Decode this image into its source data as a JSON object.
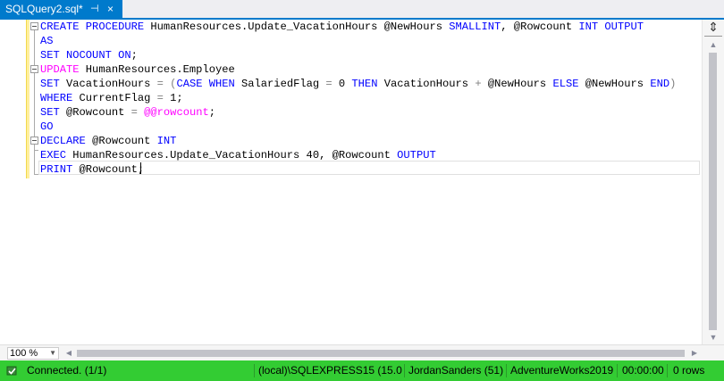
{
  "tab": {
    "title": "SQLQuery2.sql*",
    "pin": "⊣",
    "close": "×"
  },
  "editor": {
    "lines": [
      [
        {
          "t": "CREATE PROCEDURE",
          "c": "k"
        },
        {
          "t": " HumanResources.Update_VacationHours @NewHours ",
          "c": ""
        },
        {
          "t": "SMALLINT",
          "c": "k"
        },
        {
          "t": ", @Rowcount ",
          "c": ""
        },
        {
          "t": "INT OUTPUT",
          "c": "k"
        }
      ],
      [
        {
          "t": "AS",
          "c": "k"
        }
      ],
      [
        {
          "t": "SET NOCOUNT ON",
          "c": "k"
        },
        {
          "t": ";",
          "c": ""
        }
      ],
      [
        {
          "t": "UPDATE",
          "c": "f"
        },
        {
          "t": " HumanResources.Employee",
          "c": ""
        }
      ],
      [
        {
          "t": "SET",
          "c": "k"
        },
        {
          "t": " VacationHours ",
          "c": ""
        },
        {
          "t": "= (",
          "c": "g"
        },
        {
          "t": "CASE WHEN",
          "c": "k"
        },
        {
          "t": " SalariedFlag ",
          "c": ""
        },
        {
          "t": "=",
          "c": "g"
        },
        {
          "t": " 0 ",
          "c": ""
        },
        {
          "t": "THEN",
          "c": "k"
        },
        {
          "t": " VacationHours ",
          "c": ""
        },
        {
          "t": "+",
          "c": "g"
        },
        {
          "t": " @NewHours ",
          "c": ""
        },
        {
          "t": "ELSE",
          "c": "k"
        },
        {
          "t": " @NewHours ",
          "c": ""
        },
        {
          "t": "END",
          "c": "k"
        },
        {
          "t": ")",
          "c": "g"
        }
      ],
      [
        {
          "t": "WHERE",
          "c": "k"
        },
        {
          "t": " CurrentFlag ",
          "c": ""
        },
        {
          "t": "=",
          "c": "g"
        },
        {
          "t": " 1;",
          "c": ""
        }
      ],
      [
        {
          "t": "SET",
          "c": "k"
        },
        {
          "t": " @Rowcount ",
          "c": ""
        },
        {
          "t": "=",
          "c": "g"
        },
        {
          "t": " ",
          "c": ""
        },
        {
          "t": "@@rowcount",
          "c": "f"
        },
        {
          "t": ";",
          "c": ""
        }
      ],
      [
        {
          "t": "GO",
          "c": "k"
        }
      ],
      [
        {
          "t": "DECLARE",
          "c": "k"
        },
        {
          "t": " @Rowcount ",
          "c": ""
        },
        {
          "t": "INT",
          "c": "k"
        }
      ],
      [
        {
          "t": "EXEC",
          "c": "k"
        },
        {
          "t": " HumanResources.Update_VacationHours 40, @Rowcount ",
          "c": ""
        },
        {
          "t": "OUTPUT",
          "c": "k"
        }
      ],
      [
        {
          "t": "PRINT",
          "c": "k"
        },
        {
          "t": " @Rowcount;",
          "c": ""
        }
      ]
    ]
  },
  "scroll": {
    "split": "⇕",
    "up": "▲",
    "down": "▼",
    "left": "◀",
    "right": "▶"
  },
  "zoom": {
    "value": "100 %",
    "arrow": "▼"
  },
  "status": {
    "connection": "Connected. (1/1)",
    "server": "(local)\\SQLEXPRESS15 (15.0 ...",
    "user": "JordanSanders (51)",
    "database": "AdventureWorks2019",
    "elapsed": "00:00:00",
    "rows": "0 rows",
    "color": "#33cc33"
  }
}
